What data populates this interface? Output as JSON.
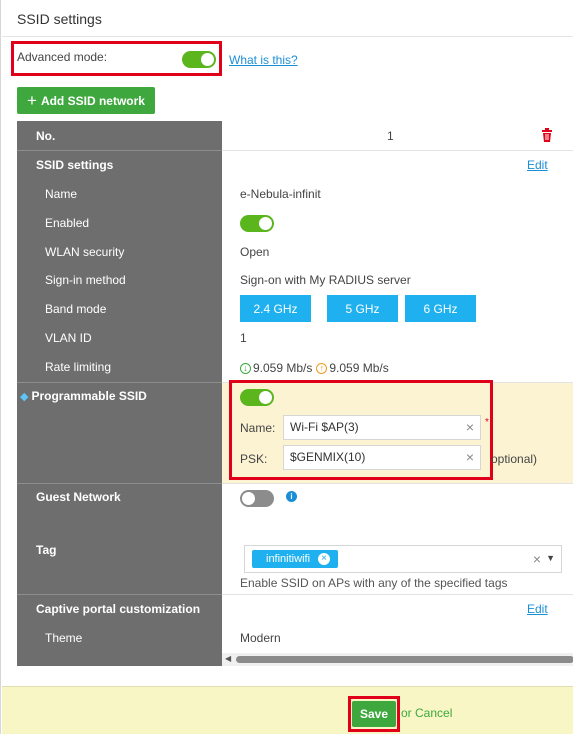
{
  "page": {
    "title": "SSID settings",
    "advanced_mode_label": "Advanced mode:",
    "advanced_mode_on": true,
    "what_is_this": "What is this?",
    "add_ssid_button": "Add SSID network"
  },
  "table": {
    "no_label": "No.",
    "no_value": "1",
    "ssid_settings_label": "SSID settings",
    "ssid_settings_edit": "Edit",
    "rows": {
      "name_label": "Name",
      "name_value": "e-Nebula-infinit",
      "enabled_label": "Enabled",
      "enabled_on": true,
      "wlan_security_label": "WLAN security",
      "wlan_security_value": "Open",
      "signin_label": "Sign-in method",
      "signin_value": "Sign-on with My RADIUS server",
      "band_label": "Band mode",
      "bands": [
        "2.4 GHz",
        "5 GHz",
        "6 GHz"
      ],
      "vlan_label": "VLAN ID",
      "vlan_value": "1",
      "rate_label": "Rate limiting",
      "rate_down": "9.059 Mb/s",
      "rate_up": "9.059 Mb/s"
    },
    "programmable": {
      "label": "Programmable SSID",
      "enabled": true,
      "name_label": "Name:",
      "name_value": "Wi-Fi $AP(3)",
      "psk_label": "PSK:",
      "psk_value": "$GENMIX(10)",
      "optional": "optional)"
    },
    "guest": {
      "label": "Guest Network",
      "enabled": false
    },
    "tag": {
      "label": "Tag",
      "chip": "infinitiwifi",
      "help": "Enable SSID on APs with any of the specified tags"
    },
    "captive": {
      "label": "Captive portal customization",
      "edit": "Edit",
      "theme_label": "Theme",
      "theme_value": "Modern"
    }
  },
  "footer": {
    "save": "Save",
    "or": "or",
    "cancel": "Cancel"
  },
  "colors": {
    "accent_green": "#3ea83e",
    "toggle_green": "#5bb51d",
    "band_blue": "#1fb0ef",
    "link_blue": "#1b8fd6",
    "highlight_red": "#e0001a",
    "label_column": "#6e6e6e",
    "programmable_bg": "#fcf3d2",
    "footer_bg": "#f8f6c5"
  }
}
